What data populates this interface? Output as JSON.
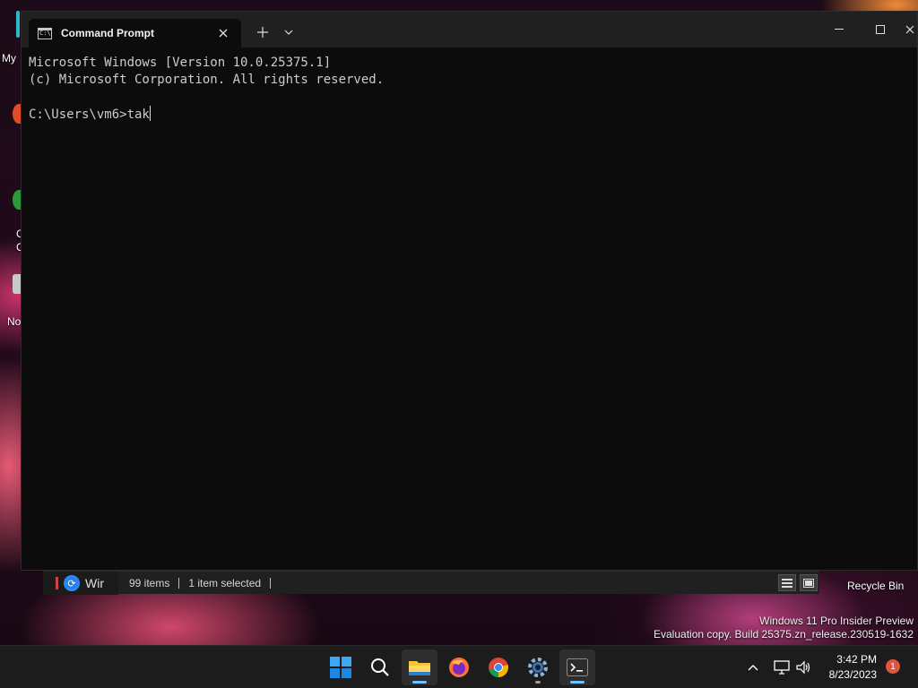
{
  "desktop": {
    "left_labels": [
      "My",
      "C",
      "C",
      "No"
    ],
    "recycle_bin": "Recycle Bin",
    "watermark_line1": "Windows 11 Pro Insider Preview",
    "watermark_line2": "Evaluation copy. Build 25375.zn_release.230519-1632"
  },
  "terminal": {
    "tab_title": "Command Prompt",
    "console_lines": [
      "Microsoft Windows [Version 10.0.25375.1]",
      "(c) Microsoft Corporation. All rights reserved.",
      "",
      "C:\\Users\\vm6>tak"
    ]
  },
  "explorer": {
    "window_label": "Wir",
    "item_count": "99 items",
    "selected": "1 item selected"
  },
  "taskbar": {
    "time": "3:42 PM",
    "date": "8/23/2023",
    "notification_count": "1"
  },
  "colors": {
    "terminal_bg": "#0c0c0c",
    "titlebar_bg": "#202020",
    "console_text": "#cccccc",
    "taskbar_bg": "#1c1c1c",
    "accent_blue": "#0078d4",
    "notification_badge": "#e0533c"
  }
}
